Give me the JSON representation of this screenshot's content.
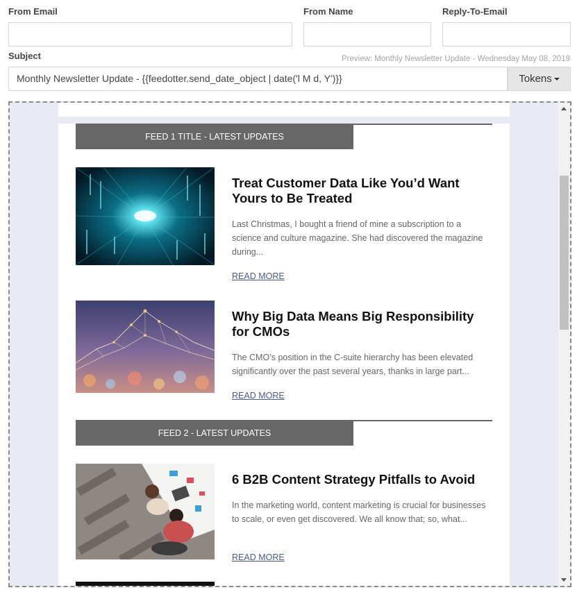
{
  "form": {
    "from_email_label": "From Email",
    "from_email_value": "",
    "from_name_label": "From Name",
    "from_name_value": "",
    "reply_to_label": "Reply-To-Email",
    "reply_to_value": "",
    "subject_label": "Subject",
    "subject_value": "Monthly Newsletter Update - {{feedotter.send_date_object | date('l M d, Y')}}",
    "preview_text": "Preview: Monthly Newsletter Update - Wednesday May 08, 2019",
    "tokens_label": "Tokens"
  },
  "email": {
    "feeds": [
      {
        "title": "FEED 1 TITLE - LATEST UPDATES",
        "articles": [
          {
            "title": "Treat Customer Data Like You’d Want Yours to Be Treated",
            "excerpt": "Last Christmas, I bought a friend of mine a subscription to a science and culture magazine. She had discovered the magazine during...",
            "read_more": "READ MORE",
            "image": "digital-data-tunnel"
          },
          {
            "title": "Why Big Data Means Big Responsibility for CMOs",
            "excerpt": "The CMO’s position in the C-suite hierarchy has been elevated significantly over the past several years, thanks in large part...",
            "read_more": "READ MORE",
            "image": "data-network-mesh"
          }
        ]
      },
      {
        "title": "FEED 2 - LATEST UPDATES",
        "articles": [
          {
            "title": "6 B2B Content Strategy Pitfalls to Avoid",
            "excerpt": "In the marketing world, content marketing is crucial for businesses to scale, or even get discovered. We all know that; so, what...",
            "read_more": "READ MORE",
            "image": "people-at-desk"
          }
        ]
      }
    ]
  },
  "colors": {
    "editor_bg": "#e9eaf4",
    "feed_bar": "#676767",
    "link": "#4b5a8c"
  }
}
